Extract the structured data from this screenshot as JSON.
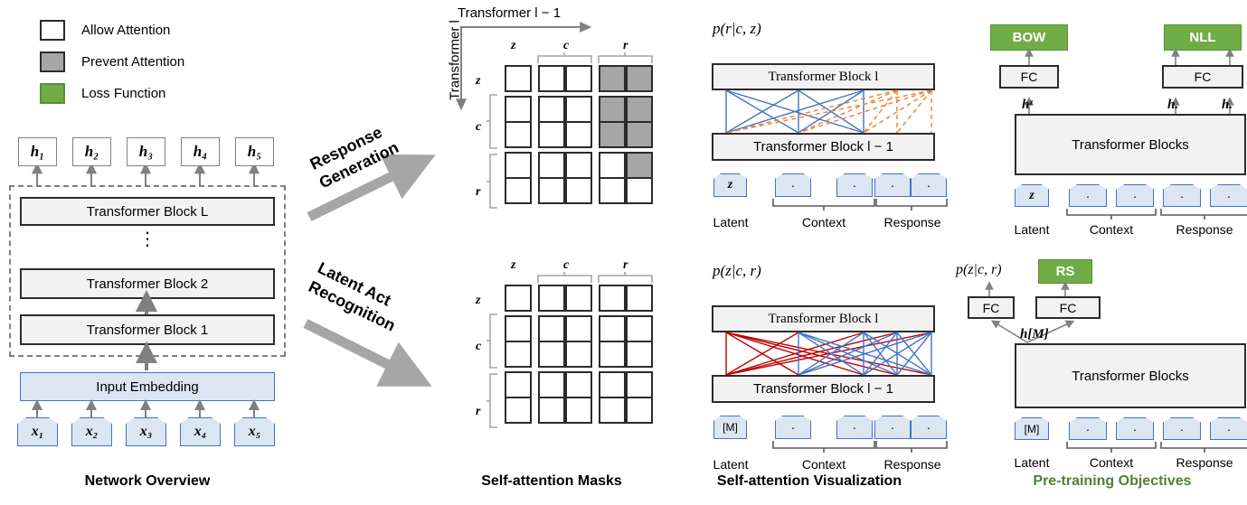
{
  "legend": {
    "items": [
      {
        "swatch": "white",
        "label": "Allow Attention"
      },
      {
        "swatch": "gray",
        "label": "Prevent Attention"
      },
      {
        "swatch": "green",
        "label": "Loss Function"
      }
    ]
  },
  "panels": {
    "network_overview": {
      "caption": "Network Overview",
      "outputs": [
        "h₁",
        "h₂",
        "h₃",
        "h₄",
        "h₅"
      ],
      "blocks": [
        "Transformer Block L",
        "Transformer Block 2",
        "Transformer Block 1"
      ],
      "vertical_ellipsis": "⋮",
      "embedding": "Input Embedding",
      "inputs": [
        "x₁",
        "x₂",
        "x₃",
        "x₄",
        "x₅"
      ]
    },
    "arrows": [
      {
        "line1": "Response",
        "line2": "Generation",
        "direction": "up"
      },
      {
        "line1": "Latent Act",
        "line2": "Recognition",
        "direction": "down"
      }
    ],
    "masks": {
      "caption": "Self-attention Masks",
      "axis_x": "Transformer l − 1",
      "axis_y": "Transformer l",
      "col_labels": [
        "z",
        "c",
        "r"
      ],
      "row_labels": [
        "z",
        "c",
        "r"
      ],
      "top_grid": [
        [
          "allow",
          "allow",
          "allow",
          "prevent",
          "prevent"
        ],
        [
          "allow",
          "allow",
          "allow",
          "prevent",
          "prevent"
        ],
        [
          "allow",
          "allow",
          "allow",
          "prevent",
          "prevent"
        ],
        [
          "allow",
          "allow",
          "allow",
          "allow",
          "prevent"
        ],
        [
          "allow",
          "allow",
          "allow",
          "allow",
          "allow"
        ]
      ],
      "bottom_grid": [
        [
          "allow",
          "allow",
          "allow",
          "allow",
          "allow"
        ],
        [
          "allow",
          "allow",
          "allow",
          "allow",
          "allow"
        ],
        [
          "allow",
          "allow",
          "allow",
          "allow",
          "allow"
        ],
        [
          "allow",
          "allow",
          "allow",
          "allow",
          "allow"
        ],
        [
          "allow",
          "allow",
          "allow",
          "allow",
          "allow"
        ]
      ]
    },
    "visualization": {
      "caption": "Self-attention Visualization",
      "top": {
        "formula": "p(r|c, z)",
        "block_upper": "Transformer Block l",
        "block_lower": "Transformer Block l − 1",
        "tokens": [
          "z",
          "·",
          "·",
          "·",
          "·"
        ],
        "groups": [
          "Latent",
          "Context",
          "Response"
        ],
        "edge_colors": {
          "bidirectional": "#4472c4",
          "unidirectional": "#ed7d31"
        }
      },
      "bottom": {
        "formula": "p(z|c, r)",
        "block_upper": "Transformer Block l",
        "block_lower": "Transformer Block l − 1",
        "tokens": [
          "[M]",
          "·",
          "·",
          "·",
          "·"
        ],
        "groups": [
          "Latent",
          "Context",
          "Response"
        ],
        "edge_colors": {
          "latent": "#c00000",
          "context_response": "#4472c4"
        }
      }
    },
    "objectives": {
      "caption": "Pre-training Objectives",
      "caption_color": "#538135",
      "top": {
        "losses": [
          "BOW",
          "NLL"
        ],
        "fc_labels": [
          "FC",
          "FC"
        ],
        "hidden_labels": [
          "hᶻ",
          "h.",
          "h."
        ],
        "blocks": "Transformer Blocks",
        "tokens": [
          "z",
          "·",
          "·",
          "·",
          "·"
        ],
        "groups": [
          "Latent",
          "Context",
          "Response"
        ]
      },
      "bottom": {
        "formula": "p(z|c, r)",
        "loss": "RS",
        "fc_labels": [
          "FC",
          "FC"
        ],
        "hidden_label": "h[M]",
        "blocks": "Transformer Blocks",
        "tokens": [
          "[M]",
          "·",
          "·",
          "·",
          "·"
        ],
        "groups": [
          "Latent",
          "Context",
          "Response"
        ]
      }
    }
  }
}
